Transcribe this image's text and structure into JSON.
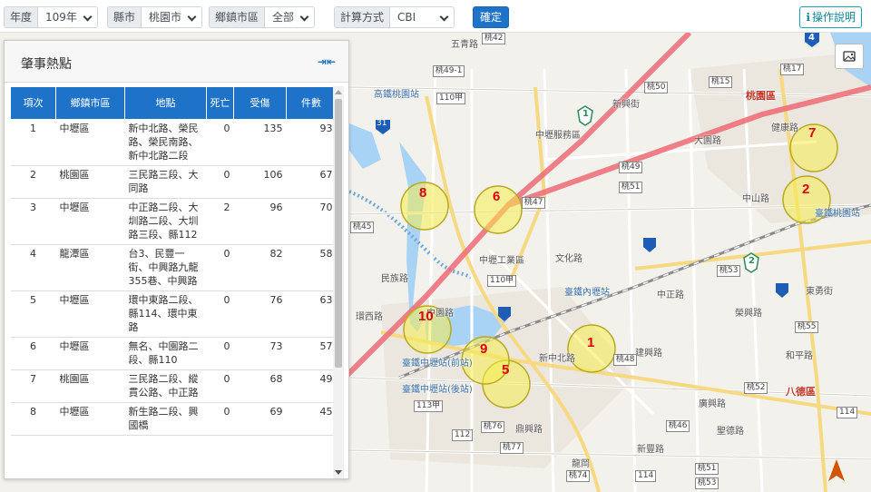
{
  "toolbar": {
    "year_label": "年度",
    "year_value": "109年",
    "city_label": "縣市",
    "city_value": "桃園市",
    "district_label": "鄉鎮市區",
    "district_value": "全部",
    "method_label": "計算方式",
    "method_value": "CBI",
    "confirm_label": "確定",
    "help_label": "操作說明"
  },
  "panel": {
    "title": "肇事熱點",
    "columns": [
      "項次",
      "鄉鎮市區",
      "地點",
      "死亡",
      "受傷",
      "件數"
    ],
    "rows": [
      {
        "no": "1",
        "district": "中壢區",
        "location": "新中北路、榮民路、榮民南路、新中北路二段",
        "deaths": "0",
        "injuries": "135",
        "cases": "93"
      },
      {
        "no": "2",
        "district": "桃園區",
        "location": "三民路三段、大同路",
        "deaths": "0",
        "injuries": "106",
        "cases": "67"
      },
      {
        "no": "3",
        "district": "中壢區",
        "location": "中正路二段、大圳路二段、大圳路三段、縣112",
        "deaths": "2",
        "injuries": "96",
        "cases": "70"
      },
      {
        "no": "4",
        "district": "龍潭區",
        "location": "台3、民豐一街、中興路九龍355巷、中興路",
        "deaths": "0",
        "injuries": "82",
        "cases": "58"
      },
      {
        "no": "5",
        "district": "中壢區",
        "location": "環中東路二段、縣114、環中東路",
        "deaths": "0",
        "injuries": "76",
        "cases": "63"
      },
      {
        "no": "6",
        "district": "中壢區",
        "location": "無名、中園路二段、縣110",
        "deaths": "0",
        "injuries": "73",
        "cases": "57"
      },
      {
        "no": "7",
        "district": "桃園區",
        "location": "三民路二段、縱貫公路、中正路",
        "deaths": "0",
        "injuries": "68",
        "cases": "49"
      },
      {
        "no": "8",
        "district": "中壢區",
        "location": "新生路二段、興國橋",
        "deaths": "0",
        "injuries": "69",
        "cases": "45"
      }
    ]
  },
  "map": {
    "hotspots": [
      "1",
      "2",
      "5",
      "6",
      "7",
      "8",
      "9",
      "10"
    ],
    "labels": {
      "wuquan": "五青路",
      "hsr_taoyuan": "高鐵桃園站",
      "zhongli_service": "中壢服務區",
      "xinxing": "新興街",
      "taoyuan_district": "桃園區",
      "zhongshan": "中山路",
      "tra_taoyuan": "臺鐵桃園站",
      "zhongli_industrial": "中壢工業區",
      "tra_neili": "臺鐵內壢站",
      "wenhua": "文化路",
      "zhongzheng": "中正路",
      "minzu": "民族路",
      "huanxi": "環西路",
      "zhongyuan": "中園路",
      "tra_zhongli_front": "臺鐵中壢站(前站)",
      "tra_zhongli_back": "臺鐵中壢站(後站)",
      "xinzhongbei": "新中北路",
      "baye": "八德區",
      "heping": "和平路",
      "jianxing": "建興路",
      "xinfeng": "新豐路",
      "dingxing": "鼎興路",
      "shengde": "聖德路",
      "rongxing": "榮興路",
      "guangzhong": "廣興路",
      "jiankang": "健康路",
      "dayuan": "大園路",
      "dongyong": "東勇街",
      "longgang": "龍岡"
    },
    "roads": {
      "r42": "桃42",
      "r49_1": "桃49-1",
      "r110": "110甲",
      "r50": "桃50",
      "r15": "桃15",
      "r17": "桃17",
      "r49": "桃49",
      "r51": "桃51",
      "r47": "桃47",
      "r45": "桃45",
      "r53": "桃53",
      "r55": "桃55",
      "r48": "桃48",
      "r52": "桃52",
      "r113": "113甲",
      "r76": "桃76",
      "r112": "112",
      "r77": "桃77",
      "r46": "桃46",
      "r74": "桃74",
      "r114": "114",
      "r51b": "桃51",
      "r53b": "桃53",
      "r114b": "114",
      "r110b": "110甲"
    },
    "shields": {
      "s1": "1",
      "s2": "2",
      "s4": "4",
      "s31": "31"
    }
  },
  "icons": {
    "help": "info-icon",
    "collapse": "collapse-icon",
    "layers": "image-icon",
    "north": "north-arrow-icon"
  },
  "colors": {
    "primary": "#1e73c9",
    "hotspot_fill": "#f5ec4e",
    "hotspot_number": "#e0000b",
    "freeway": "#f06a75"
  }
}
